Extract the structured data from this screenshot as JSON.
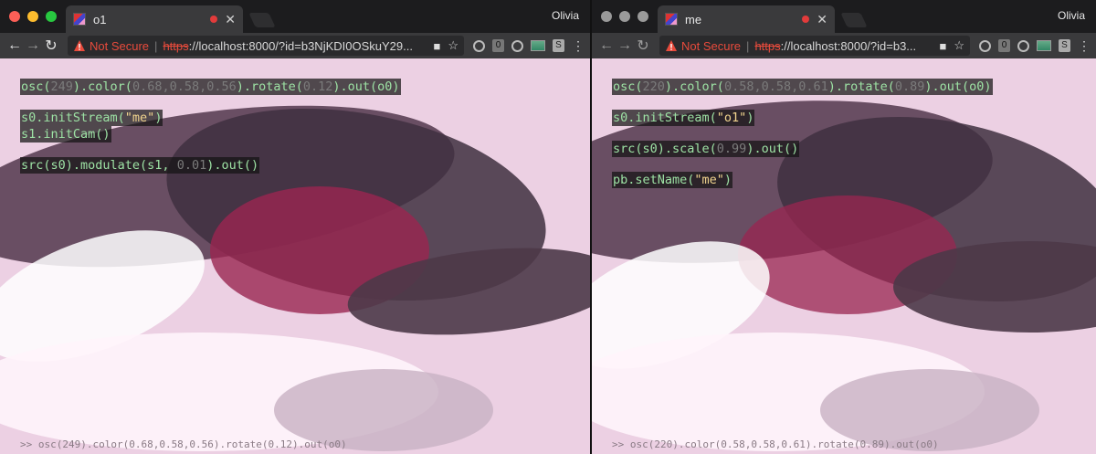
{
  "user_name": "Olivia",
  "left": {
    "tab_title": "o1",
    "url": {
      "not_secure": "Not Secure",
      "scheme": "https",
      "rest": "://localhost:8000/?id=b3NjKDI0OSkuY29..."
    },
    "code_lines": [
      {
        "parts": [
          {
            "t": "osc(",
            "c": "fn"
          },
          {
            "t": "249",
            "c": "num"
          },
          {
            "t": ").color(",
            "c": "fn"
          },
          {
            "t": "0.68,0.58,0.56",
            "c": "num"
          },
          {
            "t": ").rotate(",
            "c": "fn"
          },
          {
            "t": "0.12",
            "c": "num"
          },
          {
            "t": ").out(o0)",
            "c": "fn"
          }
        ]
      },
      {
        "gap": true
      },
      {
        "parts": [
          {
            "t": "s0.initStream(",
            "c": "fn"
          },
          {
            "t": "\"me\"",
            "c": "str"
          },
          {
            "t": ")",
            "c": "fn"
          }
        ]
      },
      {
        "parts": [
          {
            "t": "s1.initCam()",
            "c": "fn"
          }
        ]
      },
      {
        "gap": true
      },
      {
        "parts": [
          {
            "t": "src(s0).modulate(s1, ",
            "c": "fn"
          },
          {
            "t": "0.01",
            "c": "num"
          },
          {
            "t": ").out()",
            "c": "fn"
          }
        ]
      }
    ],
    "console_text": ">> osc(249).color(0.68,0.58,0.56).rotate(0.12).out(o0)"
  },
  "right": {
    "tab_title": "me",
    "url": {
      "not_secure": "Not Secure",
      "scheme": "https",
      "rest": "://localhost:8000/?id=b3..."
    },
    "code_lines": [
      {
        "parts": [
          {
            "t": "osc(",
            "c": "fn"
          },
          {
            "t": "220",
            "c": "num"
          },
          {
            "t": ").color(",
            "c": "fn"
          },
          {
            "t": "0.58,0.58,0.61",
            "c": "num"
          },
          {
            "t": ").rotate(",
            "c": "fn"
          },
          {
            "t": "0.89",
            "c": "num"
          },
          {
            "t": ").out(o0)",
            "c": "fn"
          }
        ]
      },
      {
        "gap": true
      },
      {
        "parts": [
          {
            "t": "s0.initStream(",
            "c": "fn"
          },
          {
            "t": "\"o1\"",
            "c": "str"
          },
          {
            "t": ")",
            "c": "fn"
          }
        ]
      },
      {
        "gap": true
      },
      {
        "parts": [
          {
            "t": "src(s0).scale(",
            "c": "fn"
          },
          {
            "t": "0.99",
            "c": "num"
          },
          {
            "t": ").out()",
            "c": "fn"
          }
        ]
      },
      {
        "gap": true
      },
      {
        "parts": [
          {
            "t": "pb.setName(",
            "c": "fn"
          },
          {
            "t": "\"me\"",
            "c": "str"
          },
          {
            "t": ")",
            "c": "fn"
          }
        ]
      }
    ],
    "console_text": ">> osc(220).color(0.58,0.58,0.61).rotate(0.89).out(o0)"
  },
  "extensions": {
    "badge_count": "0",
    "s_label": "S"
  },
  "colors": {
    "code_fn": "#9de2a4",
    "code_num": "#7b7b7b",
    "code_str": "#f1d48e",
    "not_secure": "#e84b3c"
  }
}
